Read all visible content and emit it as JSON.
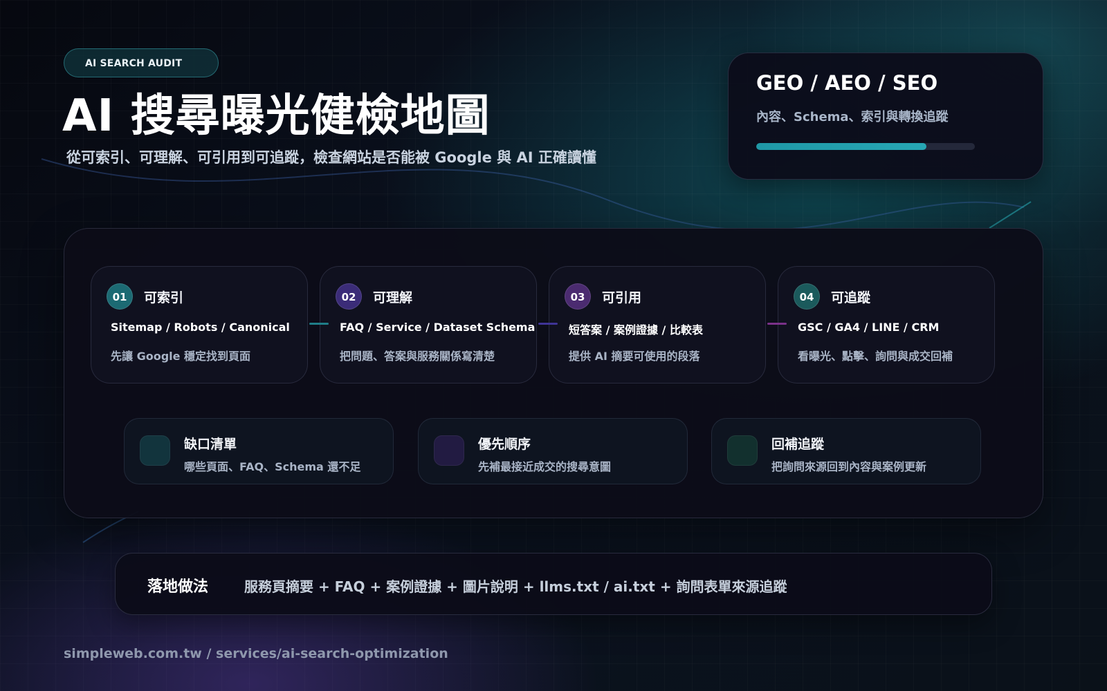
{
  "header": {
    "badge": "AI SEARCH AUDIT",
    "title": "AI 搜尋曝光健檢地圖",
    "subtitle": "從可索引、可理解、可引用到可追蹤，檢查網站是否能被 Google 與 AI 正確讀懂"
  },
  "summary_card": {
    "title": "GEO / AEO / SEO",
    "subtitle": "內容、Schema、索引與轉換追蹤",
    "progress": 0.78,
    "progress_color": "#1f98a6"
  },
  "steps": [
    {
      "number": "01",
      "title": "可索引",
      "keywords": "Sitemap / Robots / Canonical",
      "description": "先讓 Google 穩定找到頁面",
      "color": "#1c6a73"
    },
    {
      "number": "02",
      "title": "可理解",
      "keywords": "FAQ / Service / Dataset Schema",
      "description": "把問題、答案與服務關係寫清楚",
      "color": "#3b2c78"
    },
    {
      "number": "03",
      "title": "可引用",
      "keywords": "短答案 / 案例證據 / 比較表",
      "description": "提供 AI 摘要可使用的段落",
      "color": "#4b2b70"
    },
    {
      "number": "04",
      "title": "可追蹤",
      "keywords": "GSC / GA4 / LINE / CRM",
      "description": "看曝光、點擊、詢問與成交回補",
      "color": "#1b5a5c"
    }
  ],
  "connectors": [
    "#1f7d88",
    "#3f3496",
    "#7a3189"
  ],
  "outputs": [
    {
      "title": "缺口清單",
      "description": "哪些頁面、FAQ、Schema 還不足",
      "icon": "square-icon",
      "color": "#12343d"
    },
    {
      "title": "優先順序",
      "description": "先補最接近成交的搜尋意圖",
      "icon": "square-icon",
      "color": "#221b42"
    },
    {
      "title": "回補追蹤",
      "description": "把詢問來源回到內容與案例更新",
      "icon": "square-icon",
      "color": "#12302e"
    }
  ],
  "method": {
    "label": "落地做法",
    "text": "服務頁摘要 + FAQ + 案例證據 + 圖片說明 + llms.txt / ai.txt + 詢問表單來源追蹤"
  },
  "footer": {
    "url": "simpleweb.com.tw / services/ai-search-optimization"
  }
}
